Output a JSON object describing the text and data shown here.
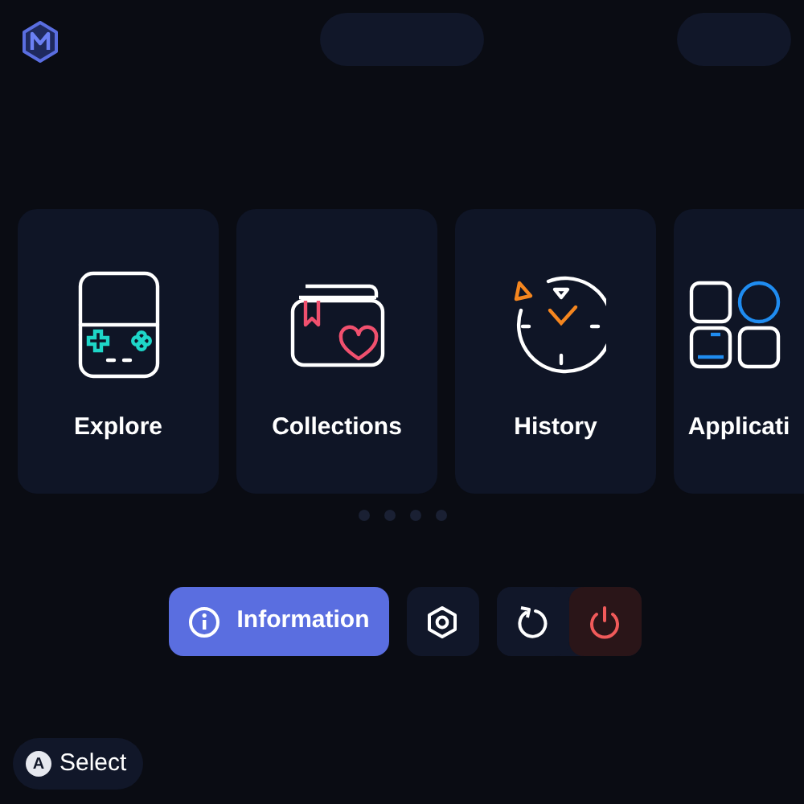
{
  "cards": [
    {
      "label": "Explore",
      "kind": "handheld"
    },
    {
      "label": "Collections",
      "kind": "collection"
    },
    {
      "label": "History",
      "kind": "history"
    },
    {
      "label": "Applicati",
      "kind": "apps"
    }
  ],
  "actions": [
    {
      "kind": "info",
      "label": "Information"
    },
    {
      "kind": "settings"
    },
    {
      "kind": "restart"
    },
    {
      "kind": "power"
    }
  ],
  "footer": {
    "button": "A",
    "label": "Select"
  }
}
